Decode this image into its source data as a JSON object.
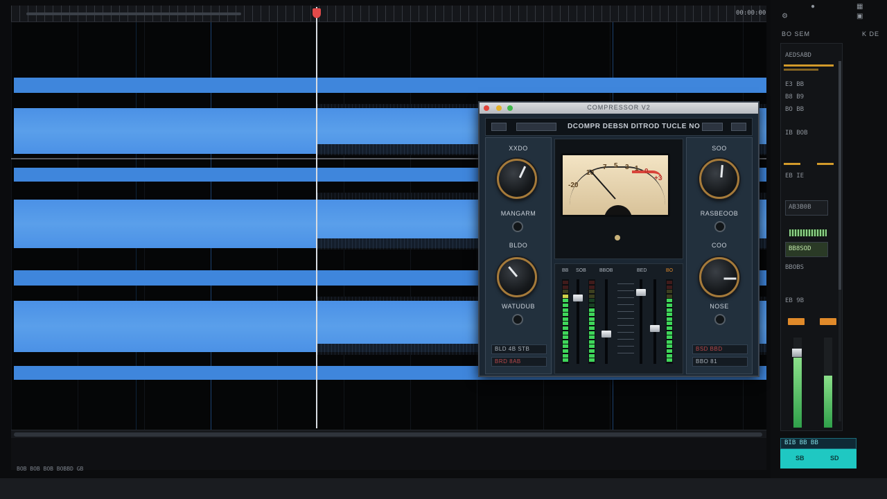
{
  "ruler": {
    "timecode": "00:00:00"
  },
  "plugin": {
    "window_title": "COMPRESSOR V2",
    "header_text": "DCOMPR  DEBSN  DITROD  TUCLE  NO",
    "left": {
      "top_label": "XXDO",
      "knob1_label": "MANGARM",
      "mid_label": "BLDO",
      "knob2_label": "WATUDUB",
      "foot1": "BLD 4B  STB",
      "foot2": "BRD  8AB"
    },
    "right": {
      "top_label": "SOO",
      "knob1_label": "RASBEOOB",
      "mid_label": "COO",
      "knob2_label": "NOSE",
      "foot1": "BSD  BBD",
      "foot2": "BBO  81"
    },
    "meter": {
      "scale_marks": [
        "-20",
        "10",
        "7",
        "5",
        "3",
        "1",
        "0",
        "+3"
      ],
      "needle_level": 0.18
    },
    "mixer_headers": [
      "BB",
      "SOB",
      "BBOB",
      "BED",
      "BO"
    ]
  },
  "right_panel": {
    "title": "BO SEM",
    "title2": "K DE",
    "subtitle": "AEDSABD",
    "rows": [
      "E3  BB",
      "B8  B9",
      "BO  BB",
      "IB  BOB",
      "EB  IE",
      "EB  9B"
    ],
    "display1": "AB3B0B",
    "display2": "BB8SOD",
    "display3": "BBOBS",
    "meter_left_level": 0.78,
    "meter_right_level": 0.58,
    "bottom_readout": "BIB  BB  BB",
    "teal_left": "SB",
    "teal_right": "SD"
  },
  "status": {
    "text": "BOB  BOB  BOB  BOBBD  GB"
  },
  "colors": {
    "waveform": "#4a8fe0",
    "accent_teal": "#1fc8c2",
    "knob_ring": "#a57a3a",
    "meter_face": "#e8d6b0",
    "led_green": "#3fd65a",
    "led_red": "#e0443a",
    "amber": "#e08a2a"
  }
}
